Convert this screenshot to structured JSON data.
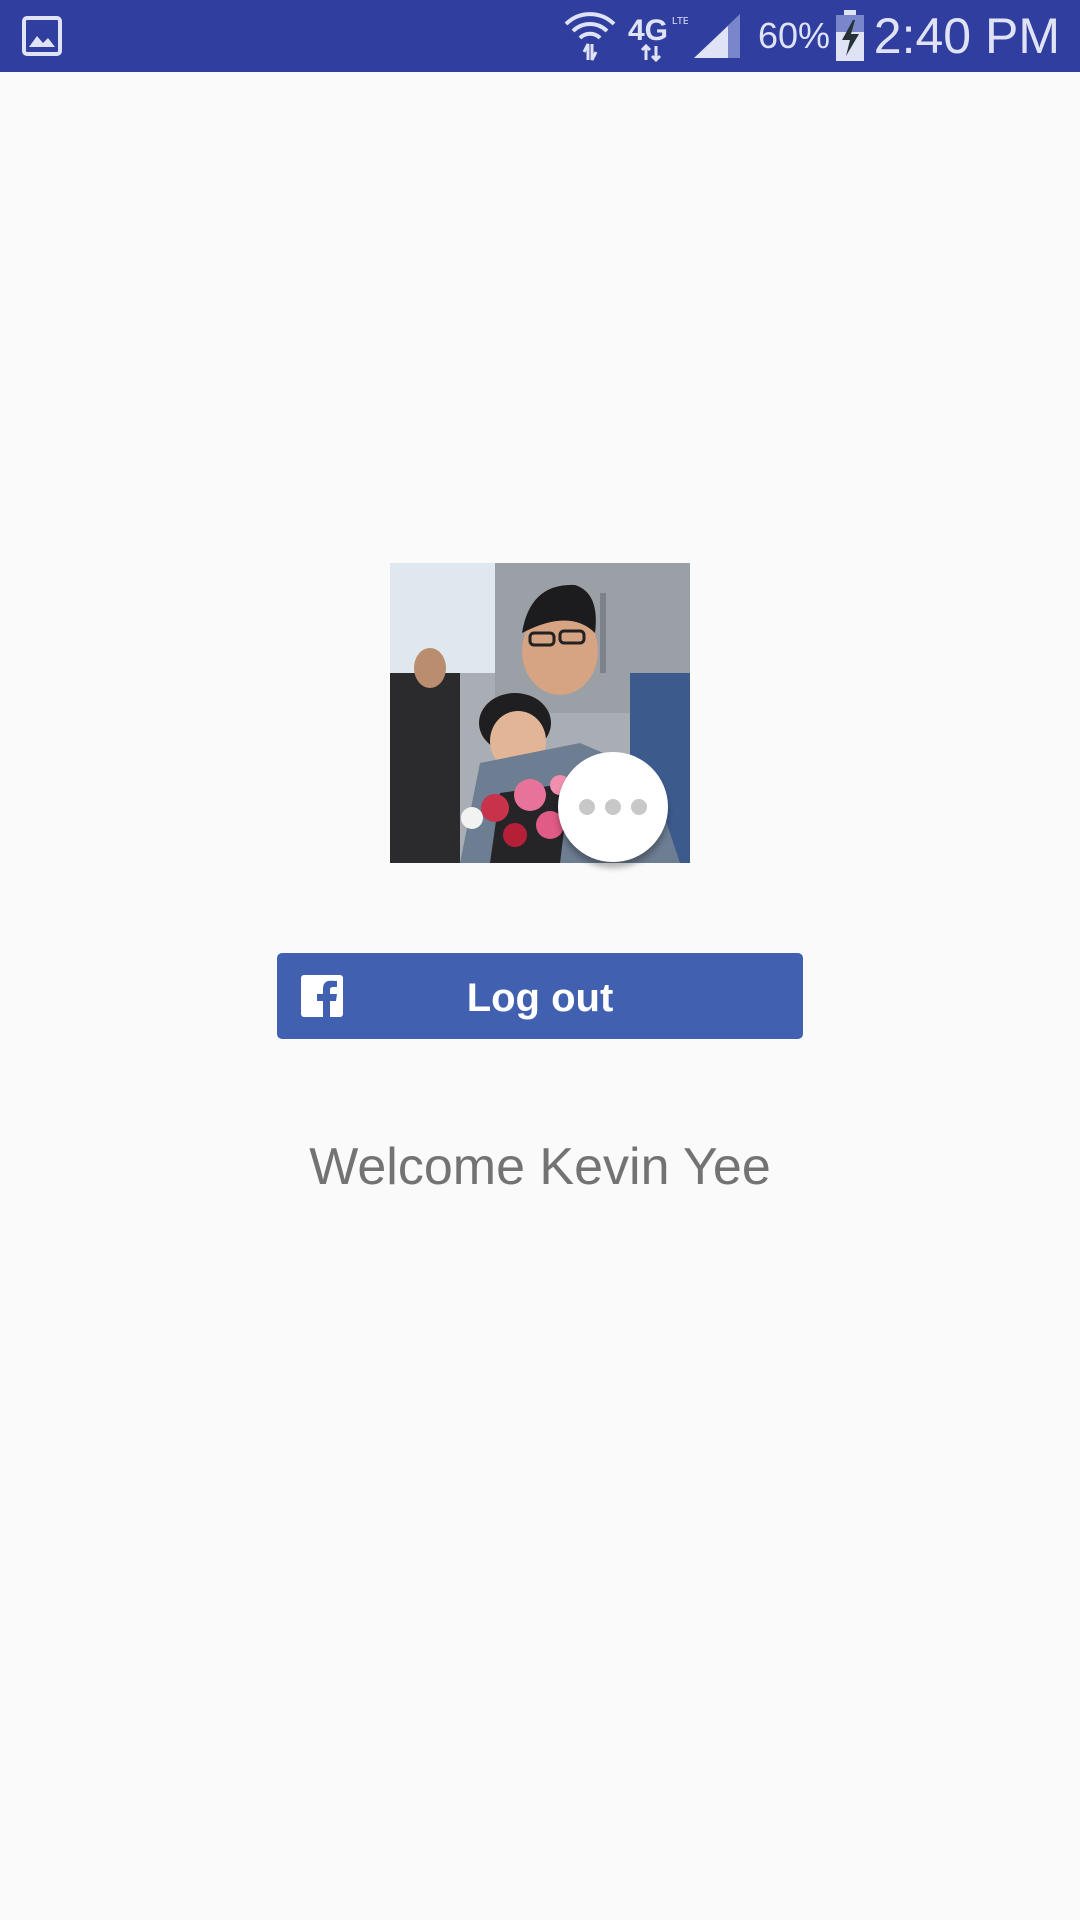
{
  "status_bar": {
    "icons": [
      "gallery-icon",
      "wifi-icon",
      "lte-4g-icon",
      "signal-icon",
      "battery-charging-icon"
    ],
    "battery_percent": "60%",
    "time": "2:40 PM",
    "background_color": "#303f9f"
  },
  "profile": {
    "photo": "profile-photo",
    "more_icon": "more-horizontal-icon"
  },
  "login_button": {
    "icon": "facebook-icon",
    "label": "Log out",
    "background_color": "#4160b0"
  },
  "welcome": {
    "text": "Welcome Kevin Yee"
  }
}
